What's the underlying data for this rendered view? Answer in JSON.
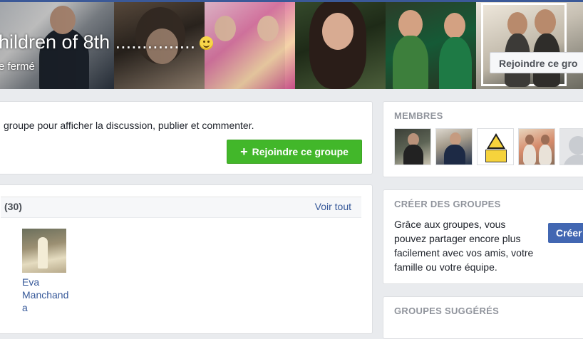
{
  "cover": {
    "title": "hildren of 8th ...............",
    "subtitle": "e fermé",
    "join_button": "Rejoindre ce gro"
  },
  "join_prompt": {
    "text": " groupe pour afficher la discussion, publier et commenter.",
    "button_label": "Rejoindre ce groupe",
    "button_color": "#42b72a"
  },
  "members_section": {
    "count": "(30)",
    "see_all": "Voir tout",
    "featured_member": {
      "name": "Eva Manchanda"
    }
  },
  "sidebar": {
    "membres": {
      "title": "MEMBRES"
    },
    "create_groups": {
      "title": "CRÉER DES GROUPES",
      "text": "Grâce aux groupes, vous pouvez partager encore plus facilement avec vos amis, votre famille ou votre équipe.",
      "button_label": "Créer",
      "button_color": "#4267b2"
    },
    "suggested": {
      "title": "GROUPES SUGGÉRÉS"
    }
  },
  "colors": {
    "link": "#365899",
    "page_bg": "#e9ebee"
  }
}
